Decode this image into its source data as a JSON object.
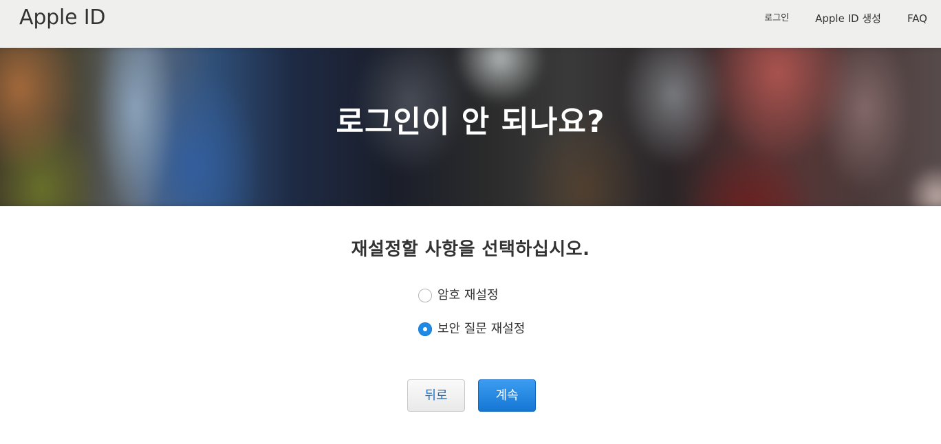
{
  "header": {
    "brand": "Apple ID",
    "nav": {
      "sign_in": "로그인",
      "create": "Apple ID 생성",
      "faq": "FAQ"
    }
  },
  "hero": {
    "title": "로그인이 안 되나요?"
  },
  "main": {
    "question": "재설정할 사항을 선택하십시오.",
    "options": [
      {
        "label": "암호 재설정",
        "selected": false
      },
      {
        "label": "보안 질문 재설정",
        "selected": true
      }
    ],
    "back_label": "뒤로",
    "continue_label": "계속"
  },
  "colors": {
    "accent": "#1f8ae6",
    "link": "#1a6fc7",
    "header_bg": "#eff0ee"
  }
}
